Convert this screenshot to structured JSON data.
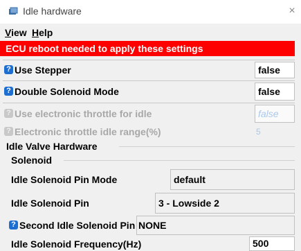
{
  "window": {
    "title": "Idle hardware",
    "close_symbol": "×"
  },
  "menu": [
    {
      "label": "View",
      "mnemonic": "V",
      "rest": "iew"
    },
    {
      "label": "Help",
      "mnemonic": "H",
      "rest": "elp"
    }
  ],
  "banner": {
    "text": "ECU reboot needed to apply these settings",
    "color": "#ff0000"
  },
  "settings": {
    "use_stepper": {
      "label": "Use Stepper",
      "value": "false"
    },
    "double_solenoid": {
      "label": "Double Solenoid Mode",
      "value": "false"
    },
    "electronic_throttle": {
      "label": "Use electronic throttle for idle",
      "value": "false"
    },
    "throttle_range": {
      "label": "Electronic throttle idle range(%)",
      "value": "5"
    }
  },
  "sections": {
    "hardware": "Idle Valve Hardware",
    "solenoid": "Solenoid"
  },
  "solenoid": {
    "pin_mode": {
      "label": "Idle Solenoid Pin Mode",
      "value": "default"
    },
    "pin": {
      "label": "Idle Solenoid Pin",
      "value": "3 - Lowside 2"
    },
    "second_pin": {
      "label": "Second Idle Solenoid Pin",
      "value": "NONE"
    },
    "frequency": {
      "label": "Idle Solenoid Frequency(Hz)",
      "value": "500"
    }
  },
  "icons": {
    "help": "?",
    "accent": "#1c6fd1"
  }
}
